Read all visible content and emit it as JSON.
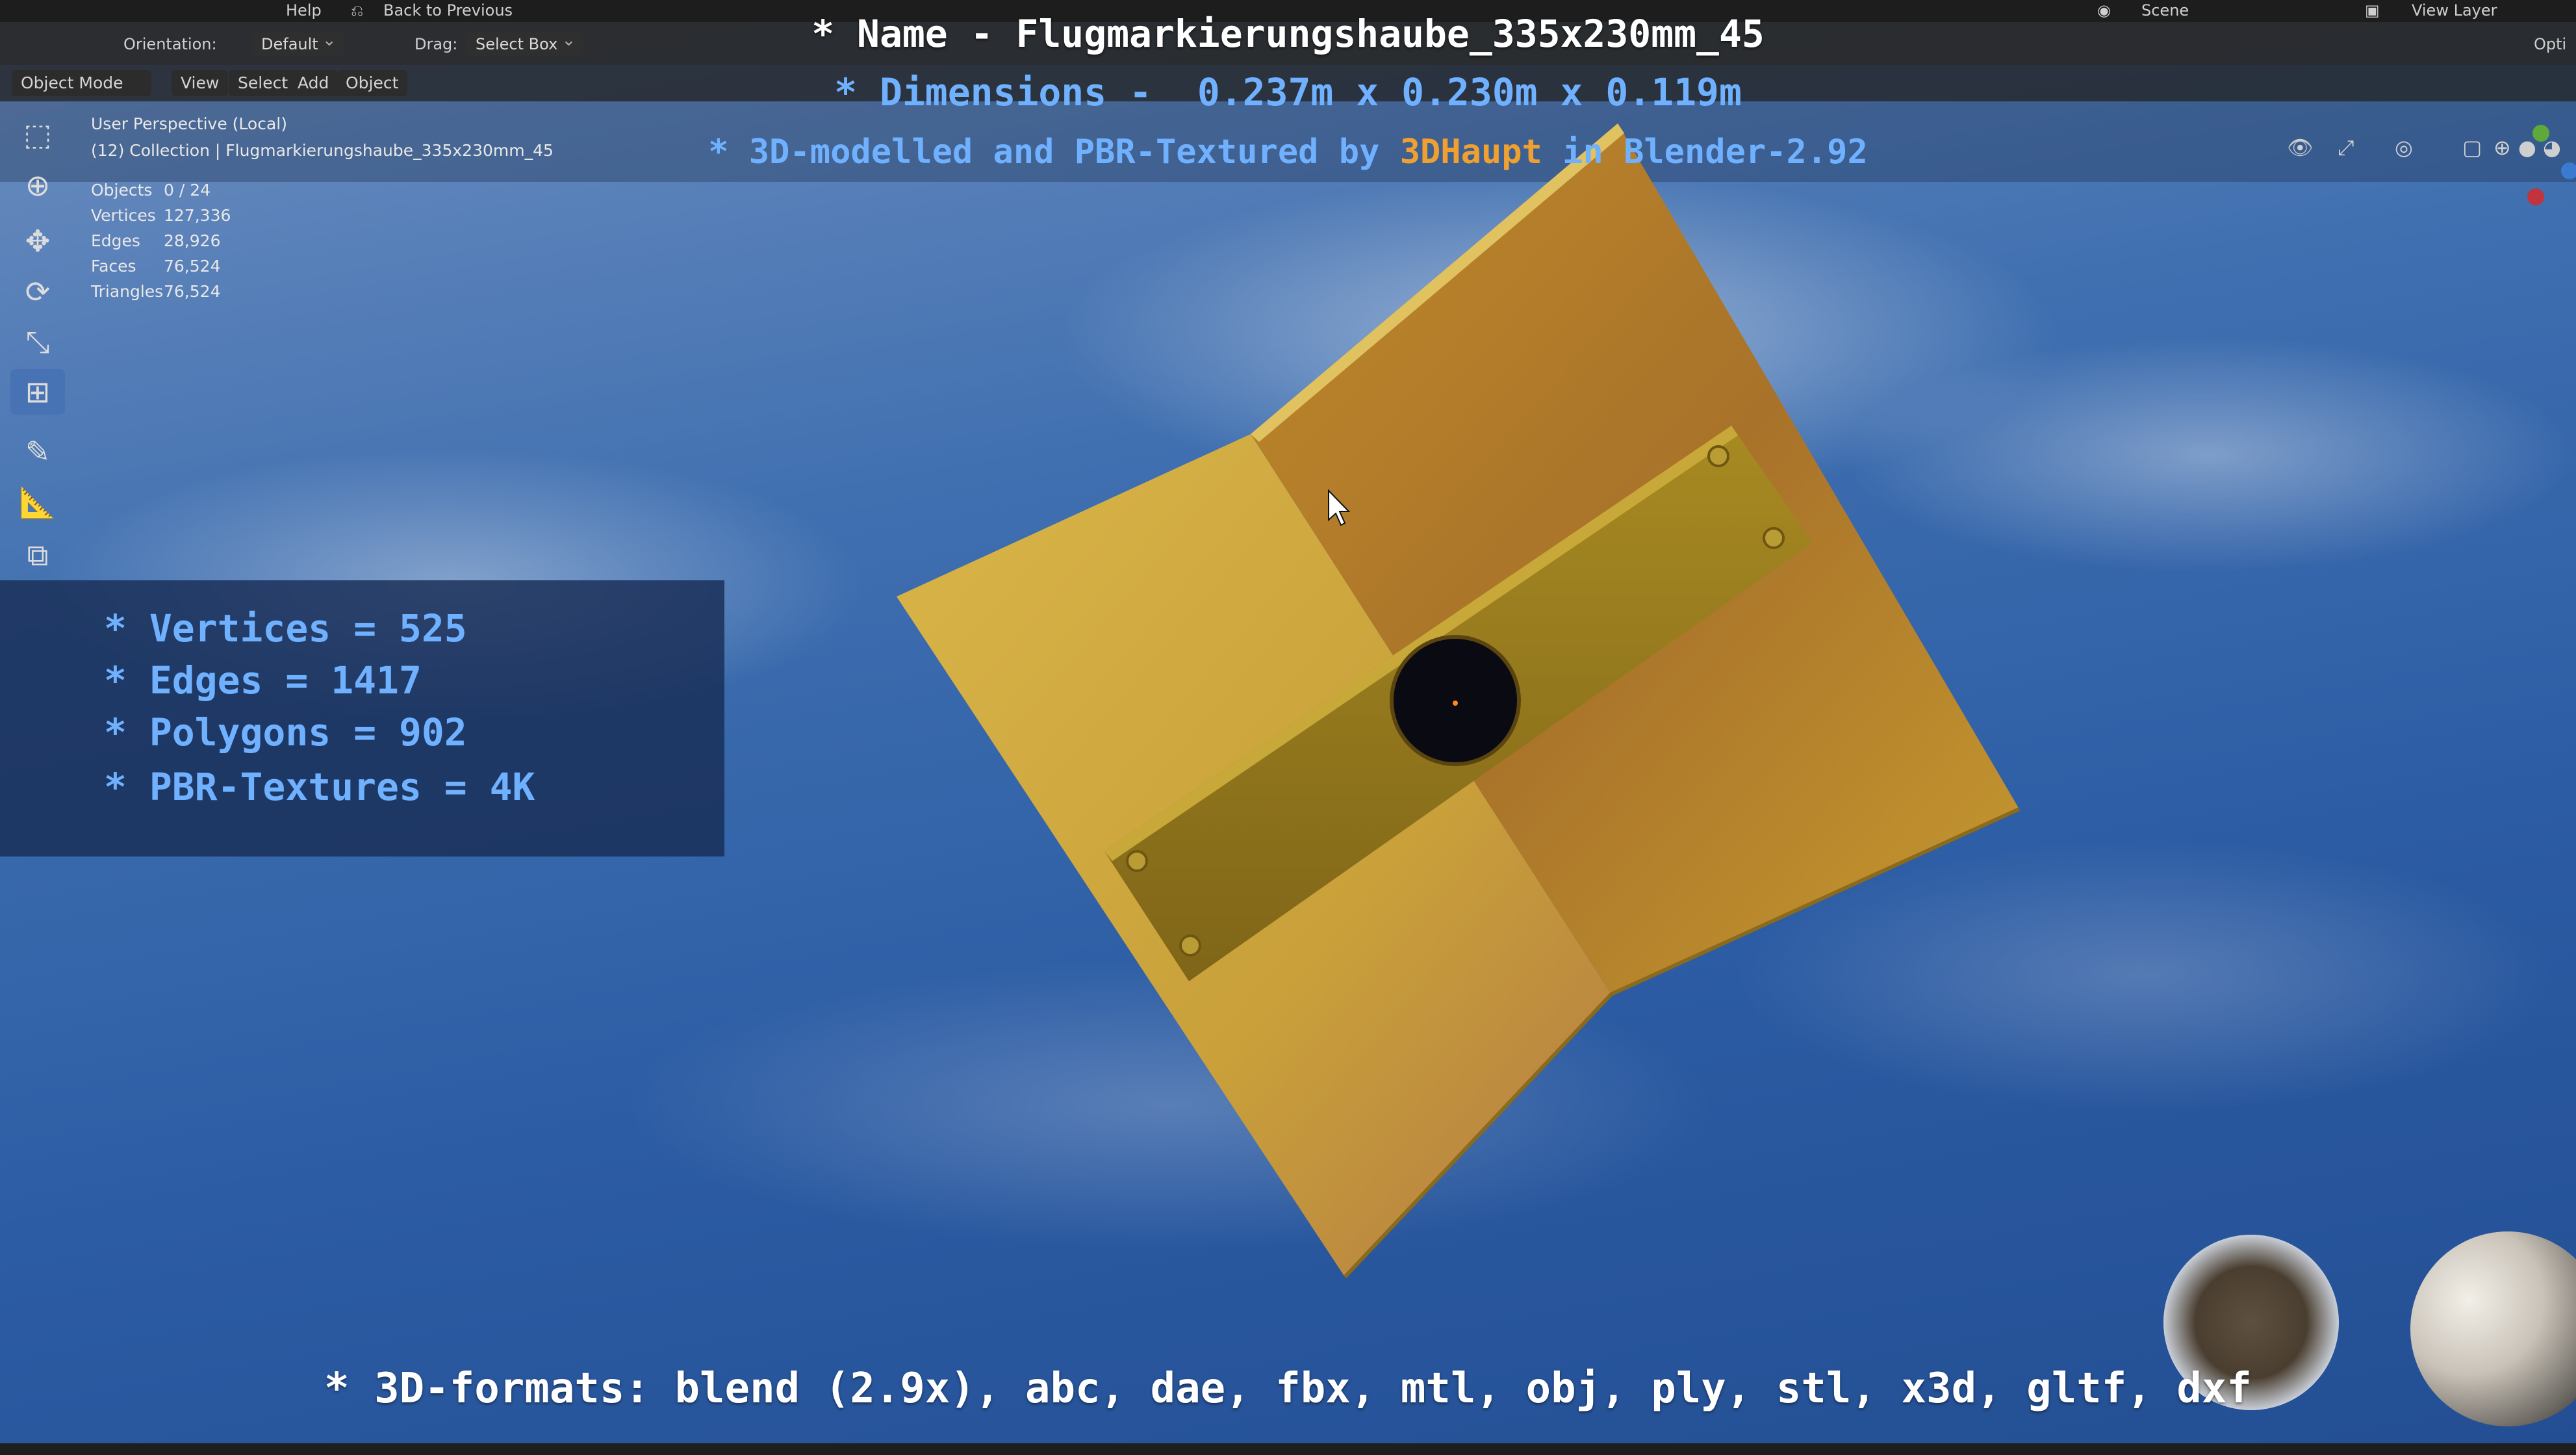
{
  "app": {
    "name": "Blender",
    "menu_help": "Help",
    "back_to_previous": "Back to Previous",
    "orientation_label": "Orientation:",
    "orientation_value": "Default",
    "drag_label": "Drag:",
    "drag_value": "Select Box",
    "scene": "Scene",
    "view_layer": "View Layer",
    "options": "Opti"
  },
  "mode_bar": {
    "mode": "Object Mode",
    "view": "View",
    "select": "Select",
    "add": "Add",
    "object": "Object"
  },
  "viewport": {
    "perspective": "User Perspective (Local)",
    "collection": "(12) Collection | Flugmarkierungshaube_335x230mm_45"
  },
  "stats": [
    {
      "label": "Objects",
      "value": "0 / 24"
    },
    {
      "label": "Vertices",
      "value": "127,336"
    },
    {
      "label": "Edges",
      "value": "28,926"
    },
    {
      "label": "Faces",
      "value": "76,524"
    },
    {
      "label": "Triangles",
      "value": "76,524"
    }
  ],
  "titles": {
    "name": "* Name - Flugmarkierungshaube_335x230mm_45",
    "dimensions_prefix": "* Dimensions -  ",
    "dimensions_value": "0.237m x 0.230m x 0.119m",
    "credit_prefix": "* 3D-modelled and PBR-Textured by ",
    "credit_author": "3DHaupt",
    "credit_suffix": " in Blender-2.92"
  },
  "model_info": [
    "* Vertices = 525",
    "* Edges = 1417",
    "* Polygons = 902",
    "* PBR-Textures = 4K"
  ],
  "formats": "* 3D-formats: blend (2.9x), abc, dae, fbx, mtl, obj, ply, stl, x3d, gltf, dxf",
  "colors": {
    "accent_blue": "#6fb1ff",
    "credit_orange": "#f0a030",
    "active_tool": "#4772b3",
    "model_yellow": "#c9a42a"
  },
  "icons": {
    "tools": [
      "select-box-icon",
      "cursor-icon",
      "move-icon",
      "rotate-icon",
      "scale-icon",
      "transform-icon",
      "annotate-icon",
      "measure-icon",
      "add-cube-icon"
    ]
  }
}
